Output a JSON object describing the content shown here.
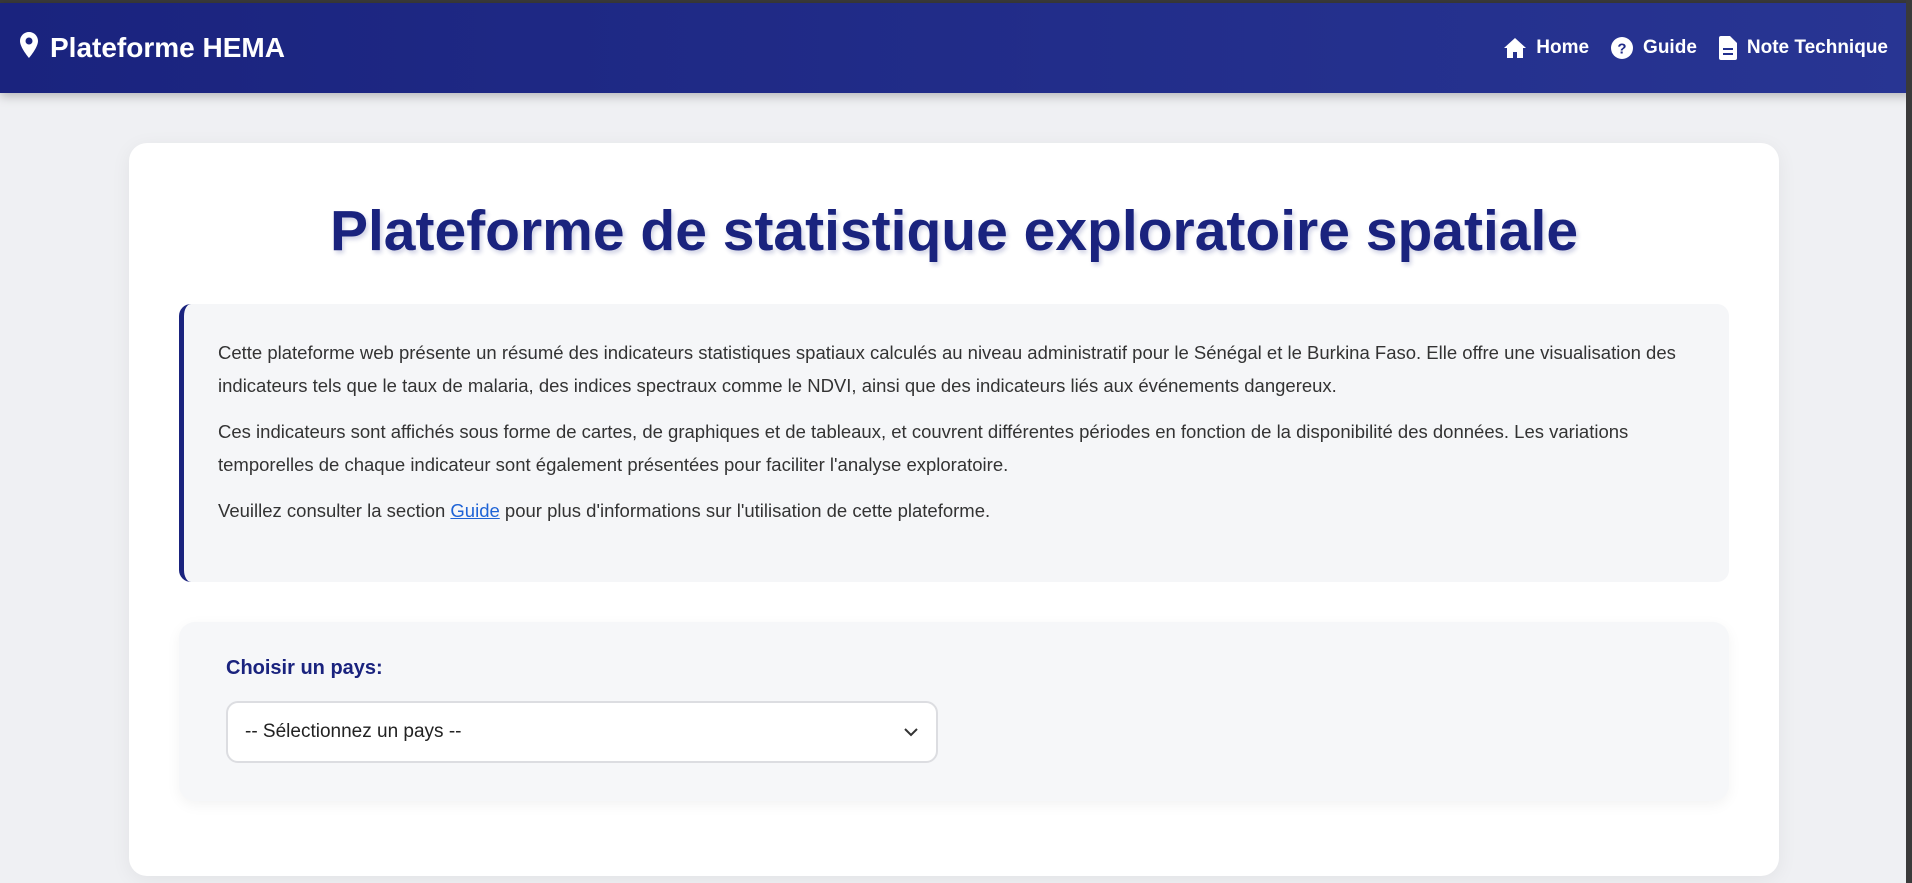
{
  "header": {
    "brand": "Plateforme HEMA",
    "nav": [
      {
        "label": "Home",
        "icon": "home-icon"
      },
      {
        "label": "Guide",
        "icon": "help-circle-icon"
      },
      {
        "label": "Note Technique",
        "icon": "document-icon"
      }
    ]
  },
  "main": {
    "title": "Plateforme de statistique exploratoire spatiale",
    "intro": {
      "p1": "Cette plateforme web présente un résumé des indicateurs statistiques spatiaux calculés au niveau administratif pour le Sénégal et le Burkina Faso. Elle offre une visualisation des indicateurs tels que le taux de malaria, des indices spectraux comme le NDVI, ainsi que des indicateurs liés aux événements dangereux.",
      "p2": "Ces indicateurs sont affichés sous forme de cartes, de graphiques et de tableaux, et couvrent différentes périodes en fonction de la disponibilité des données. Les variations temporelles de chaque indicateur sont également présentées pour faciliter l'analyse exploratoire.",
      "p3_before": "Veuillez consulter la section ",
      "p3_link": "Guide",
      "p3_after": " pour plus d'informations sur l'utilisation de cette plateforme."
    },
    "country_selector": {
      "label": "Choisir un pays:",
      "selected": "-- Sélectionnez un pays --"
    }
  },
  "colors": {
    "primary": "#1a237e",
    "link": "#1e63d6"
  }
}
